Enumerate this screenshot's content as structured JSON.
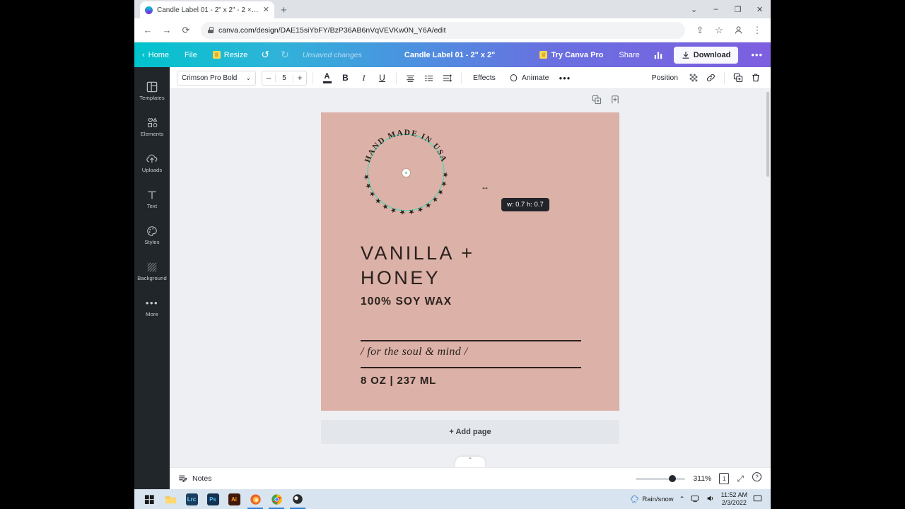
{
  "browser": {
    "tab": {
      "title": "Candle Label 01 - 2\" x 2\" - 2 × 2...",
      "favicon": "canva-icon",
      "close": "✕"
    },
    "newtab": "+",
    "window_controls": {
      "chevron": "⌄",
      "minimize": "–",
      "maximize": "❐",
      "close": "✕"
    },
    "nav": {
      "back": "←",
      "forward": "→",
      "reload": "⟳"
    },
    "omnibox": {
      "url": "canva.com/design/DAE15siYbFY/BzP36AB6nVqVEVKw0N_Y6A/edit",
      "lock": "lock-icon"
    },
    "omnibox_actions": {
      "share": "⇪",
      "bookmark": "☆",
      "profile": "●",
      "menu": "⋮"
    }
  },
  "canva_top": {
    "home": "Home",
    "file": "File",
    "resize": "Resize",
    "undo": "↺",
    "redo": "↻",
    "unsaved": "Unsaved changes",
    "doc_title": "Candle Label 01 - 2\" x 2\"",
    "try_pro": "Try Canva Pro",
    "share": "Share",
    "insights": "insights-icon",
    "download": "Download",
    "more": "•••",
    "gradient_start": "#00c4cc",
    "gradient_end": "#7d5fe0"
  },
  "sidebar": {
    "items": [
      {
        "label": "Templates",
        "icon": "templates-icon"
      },
      {
        "label": "Elements",
        "icon": "elements-icon"
      },
      {
        "label": "Uploads",
        "icon": "uploads-icon"
      },
      {
        "label": "Text",
        "icon": "text-icon"
      },
      {
        "label": "Styles",
        "icon": "styles-icon"
      },
      {
        "label": "Background",
        "icon": "background-icon"
      },
      {
        "label": "More",
        "icon": "more-icon"
      }
    ]
  },
  "format_toolbar": {
    "font": "Crimson Pro Bold",
    "font_chevron": "⌄",
    "size_minus": "–",
    "size_value": "5",
    "size_plus": "+",
    "text_color": "A",
    "bold": "B",
    "italic": "I",
    "underline": "U",
    "align": "align-icon",
    "list": "list-icon",
    "spacing": "spacing-icon",
    "effects": "Effects",
    "animate": "Animate",
    "more": "•••",
    "position": "Position",
    "transparency": "transparency-icon",
    "link": "link-icon",
    "duplicate": "duplicate-icon",
    "delete": "trash-icon"
  },
  "canvas": {
    "page_controls": {
      "duplicate": "duplicate-page-icon",
      "add": "add-page-icon"
    },
    "background_color": "#dbb1a8",
    "badge": {
      "arc_text": "HAND MADE IN USA",
      "stars": "★★★★★★★★★★★★★★★★★★★★",
      "ring_color": "#6ecfb0"
    },
    "tooltip": "w: 0.7 h: 0.7",
    "label": {
      "title_line1": "VANILLA +",
      "title_line2": "HONEY",
      "subtitle": "100% SOY WAX",
      "tagline": "/ for the soul & mind /",
      "size": "8 OZ | 237 ML"
    },
    "add_page": "+ Add page"
  },
  "bottom_bar": {
    "notes": "Notes",
    "zoom": "311%",
    "page_number": "1",
    "fullscreen": "⤢",
    "help": "?"
  },
  "taskbar": {
    "start": "start-icon",
    "apps": [
      {
        "name": "file-explorer",
        "label": "",
        "color": "#f5c344"
      },
      {
        "name": "lightroom",
        "label": "Lrc",
        "color": "#1b3d5e"
      },
      {
        "name": "photoshop",
        "label": "Ps",
        "color": "#14324f"
      },
      {
        "name": "illustrator",
        "label": "Ai",
        "color": "#41190a"
      },
      {
        "name": "firefox",
        "label": "",
        "color": "#e8642a"
      },
      {
        "name": "chrome",
        "label": "",
        "color": "#4285f4"
      },
      {
        "name": "obs",
        "label": "",
        "color": "#2b2b2b"
      }
    ],
    "tray": {
      "weather": "Rain/snow",
      "chevron": "⌃",
      "network": "network-icon",
      "volume": "volume-icon",
      "time": "11:52 AM",
      "date": "2/3/2022",
      "notifications": "notification-icon"
    }
  }
}
